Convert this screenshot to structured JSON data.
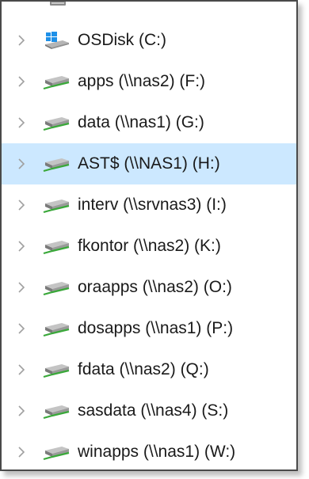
{
  "tree": {
    "items": [
      {
        "label": "OSDisk (C:)",
        "icon": "windows-drive-icon",
        "selected": false
      },
      {
        "label": "apps (\\\\nas2) (F:)",
        "icon": "network-drive-icon",
        "selected": false
      },
      {
        "label": "data (\\\\nas1) (G:)",
        "icon": "network-drive-icon",
        "selected": false
      },
      {
        "label": "AST$ (\\\\NAS1) (H:)",
        "icon": "network-drive-icon",
        "selected": true
      },
      {
        "label": "interv (\\\\srvnas3) (I:)",
        "icon": "network-drive-icon",
        "selected": false
      },
      {
        "label": "fkontor (\\\\nas2) (K:)",
        "icon": "network-drive-icon",
        "selected": false
      },
      {
        "label": "oraapps (\\\\nas2) (O:)",
        "icon": "network-drive-icon",
        "selected": false
      },
      {
        "label": "dosapps (\\\\nas1) (P:)",
        "icon": "network-drive-icon",
        "selected": false
      },
      {
        "label": "fdata (\\\\nas2) (Q:)",
        "icon": "network-drive-icon",
        "selected": false
      },
      {
        "label": "sasdata (\\\\nas4) (S:)",
        "icon": "network-drive-icon",
        "selected": false
      },
      {
        "label": "winapps (\\\\nas1) (W:)",
        "icon": "network-drive-icon",
        "selected": false
      }
    ]
  },
  "colors": {
    "selection": "#cce8ff",
    "chevron": "#a0a0a0",
    "text": "#1a1a1a",
    "windows_blue": "#1e90e8",
    "network_green": "#3aa83a"
  }
}
